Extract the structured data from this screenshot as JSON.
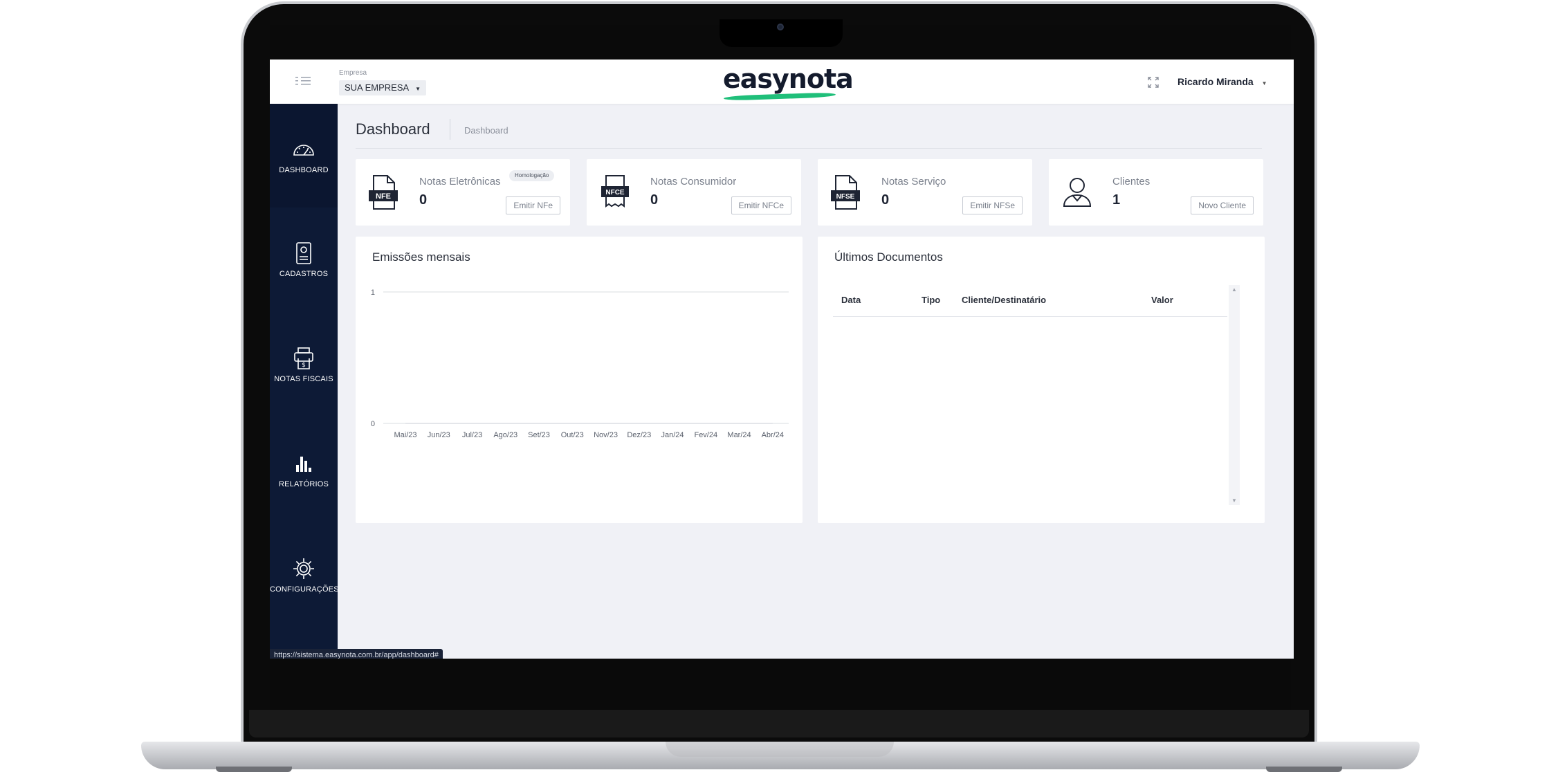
{
  "topbar": {
    "company_label": "Empresa",
    "company_value": "SUA EMPRESA",
    "logo_text": "easynota",
    "user_name": "Ricardo Miranda"
  },
  "sidebar": {
    "items": [
      {
        "label": "DASHBOARD",
        "icon": "gauge-icon",
        "active": true
      },
      {
        "label": "CADASTROS",
        "icon": "id-badge-icon",
        "active": false
      },
      {
        "label": "NOTAS FISCAIS",
        "icon": "receipt-printer-icon",
        "active": false
      },
      {
        "label": "RELATÓRIOS",
        "icon": "bar-chart-icon",
        "active": false
      },
      {
        "label": "CONFIGURAÇÕES",
        "icon": "gear-icon",
        "active": false
      }
    ]
  },
  "page": {
    "title": "Dashboard",
    "breadcrumb": "Dashboard"
  },
  "cards": [
    {
      "title": "Notas Eletrônicas",
      "value": "0",
      "button": "Emitir NFe",
      "icon": "nfe-document-icon",
      "icon_text": "NFE",
      "badge": "Homologação"
    },
    {
      "title": "Notas Consumidor",
      "value": "0",
      "button": "Emitir NFCe",
      "icon": "nfce-receipt-icon",
      "icon_text": "NFCE"
    },
    {
      "title": "Notas Serviço",
      "value": "0",
      "button": "Emitir NFSe",
      "icon": "nfse-document-icon",
      "icon_text": "NFSE"
    },
    {
      "title": "Clientes",
      "value": "1",
      "button": "Novo Cliente",
      "icon": "user-icon"
    }
  ],
  "emissoes": {
    "title": "Emissões mensais"
  },
  "chart_data": {
    "type": "line",
    "title": "Emissões mensais",
    "categories": [
      "Mai/23",
      "Jun/23",
      "Jul/23",
      "Ago/23",
      "Set/23",
      "Out/23",
      "Nov/23",
      "Dez/23",
      "Jan/24",
      "Fev/24",
      "Mar/24",
      "Abr/24"
    ],
    "values": [
      0,
      0,
      0,
      0,
      0,
      0,
      0,
      0,
      0,
      0,
      0,
      0
    ],
    "ylim": [
      0,
      1
    ],
    "yticks": [
      "0",
      "1"
    ],
    "xlabel": "",
    "ylabel": "",
    "grid": true
  },
  "documentos": {
    "title": "Últimos Documentos",
    "columns": [
      "Data",
      "Tipo",
      "Cliente/Destinatário",
      "Valor"
    ],
    "rows": []
  },
  "status_bar": {
    "url": "https://sistema.easynota.com.br/app/dashboard#"
  },
  "colors": {
    "sidebar": "#0d1a36",
    "accent_green": "#1fbf7a",
    "background": "#f0f1f6"
  }
}
